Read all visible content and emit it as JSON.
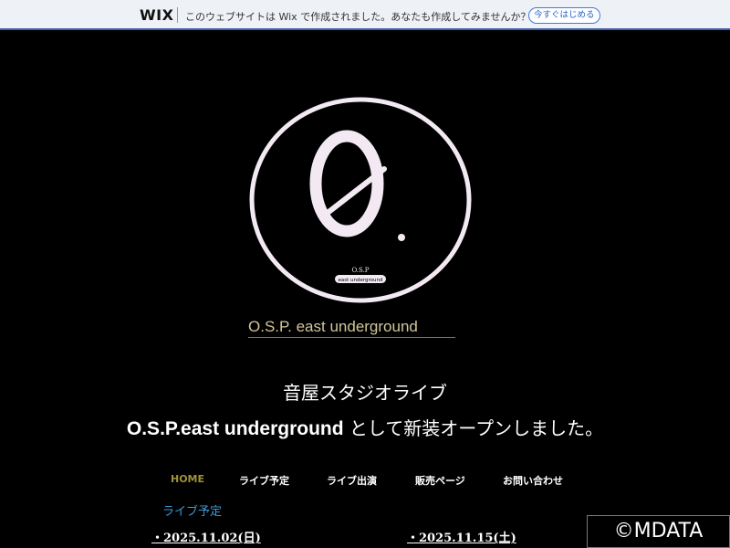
{
  "wix_banner": {
    "logo_text": "WIX",
    "message": "このウェブサイトは Wix で作成されました。あなたも作成してみませんか？",
    "cta_label": "今すぐはじめる"
  },
  "logo": {
    "line1": "O.S.P",
    "line2": "east underground"
  },
  "site_title": "O.S.P. east underground",
  "headline": {
    "line1": "音屋スタジオライブ",
    "line2_latin": "O.S.P.east underground",
    "line2_rest": " として新装オープンしました。"
  },
  "nav": [
    {
      "label": "HOME"
    },
    {
      "label": "ライブ予定"
    },
    {
      "label": "ライブ出演"
    },
    {
      "label": "販売ページ"
    },
    {
      "label": "お問い合わせ"
    }
  ],
  "live_schedule": {
    "label": "ライブ予定",
    "dates": [
      "・2025.11.02(日)",
      "・2025.11.15(土)"
    ]
  },
  "watermark": "©MDATA",
  "colors": {
    "background": "#000000",
    "nav_active": "#a09236",
    "section_label": "#3d9bd6",
    "site_title": "#d2c59a"
  }
}
